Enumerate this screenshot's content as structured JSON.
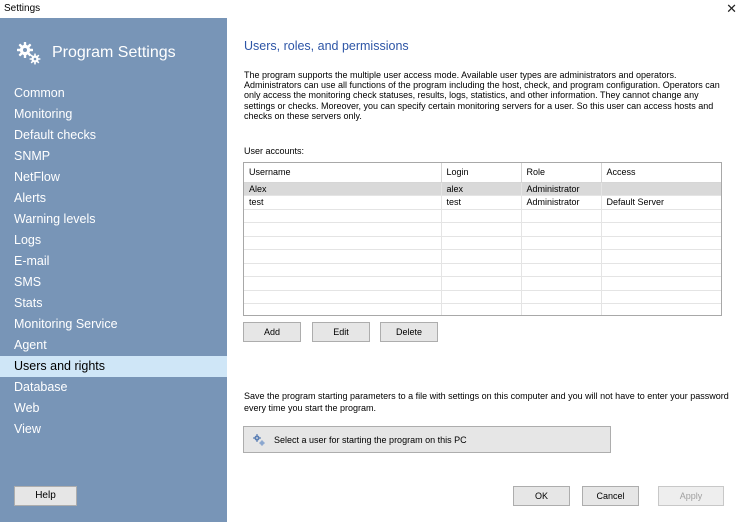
{
  "window": {
    "title": "Settings",
    "close_glyph": "✕"
  },
  "sidebar": {
    "title": "Program Settings",
    "icon": "gears-icon",
    "items": [
      {
        "label": "Common"
      },
      {
        "label": "Monitoring"
      },
      {
        "label": "Default checks"
      },
      {
        "label": "SNMP"
      },
      {
        "label": "NetFlow"
      },
      {
        "label": "Alerts"
      },
      {
        "label": "Warning levels"
      },
      {
        "label": "Logs"
      },
      {
        "label": "E-mail"
      },
      {
        "label": "SMS"
      },
      {
        "label": "Stats"
      },
      {
        "label": "Monitoring Service"
      },
      {
        "label": "Agent"
      },
      {
        "label": "Users and rights",
        "active": true
      },
      {
        "label": "Database"
      },
      {
        "label": "Web"
      },
      {
        "label": "View"
      }
    ],
    "help_label": "Help"
  },
  "main": {
    "heading": "Users, roles, and permissions",
    "description": "The program supports the multiple user access mode. Available user types are administrators and operators. Administrators can use all functions of the program including the host, check, and program configuration. Operators can only access the monitoring check statuses, results, logs, statistics, and other information. They cannot change any settings or checks. Moreover, you can specify certain monitoring servers for a user. So this user can access hosts and checks on these servers only.",
    "accounts_label": "User accounts:",
    "table": {
      "columns": [
        "Username",
        "Login",
        "Role",
        "Access"
      ],
      "rows": [
        [
          "Alex",
          "alex",
          "Administrator",
          ""
        ],
        [
          "test",
          "test",
          "Administrator",
          "Default Server"
        ]
      ],
      "selected_row": 0
    },
    "buttons": {
      "add": "Add",
      "edit": "Edit",
      "delete": "Delete"
    },
    "save_text": "Save the program starting parameters to a file with settings on this computer and you will not have to enter your password every time you start the program.",
    "select_user_label": "Select a user for starting the program on this PC"
  },
  "footer": {
    "ok": "OK",
    "cancel": "Cancel",
    "apply": "Apply"
  },
  "colors": {
    "sidebar_bg": "#7895b7",
    "active_item_bg": "#cfe6f7",
    "heading": "#2d55a6"
  }
}
